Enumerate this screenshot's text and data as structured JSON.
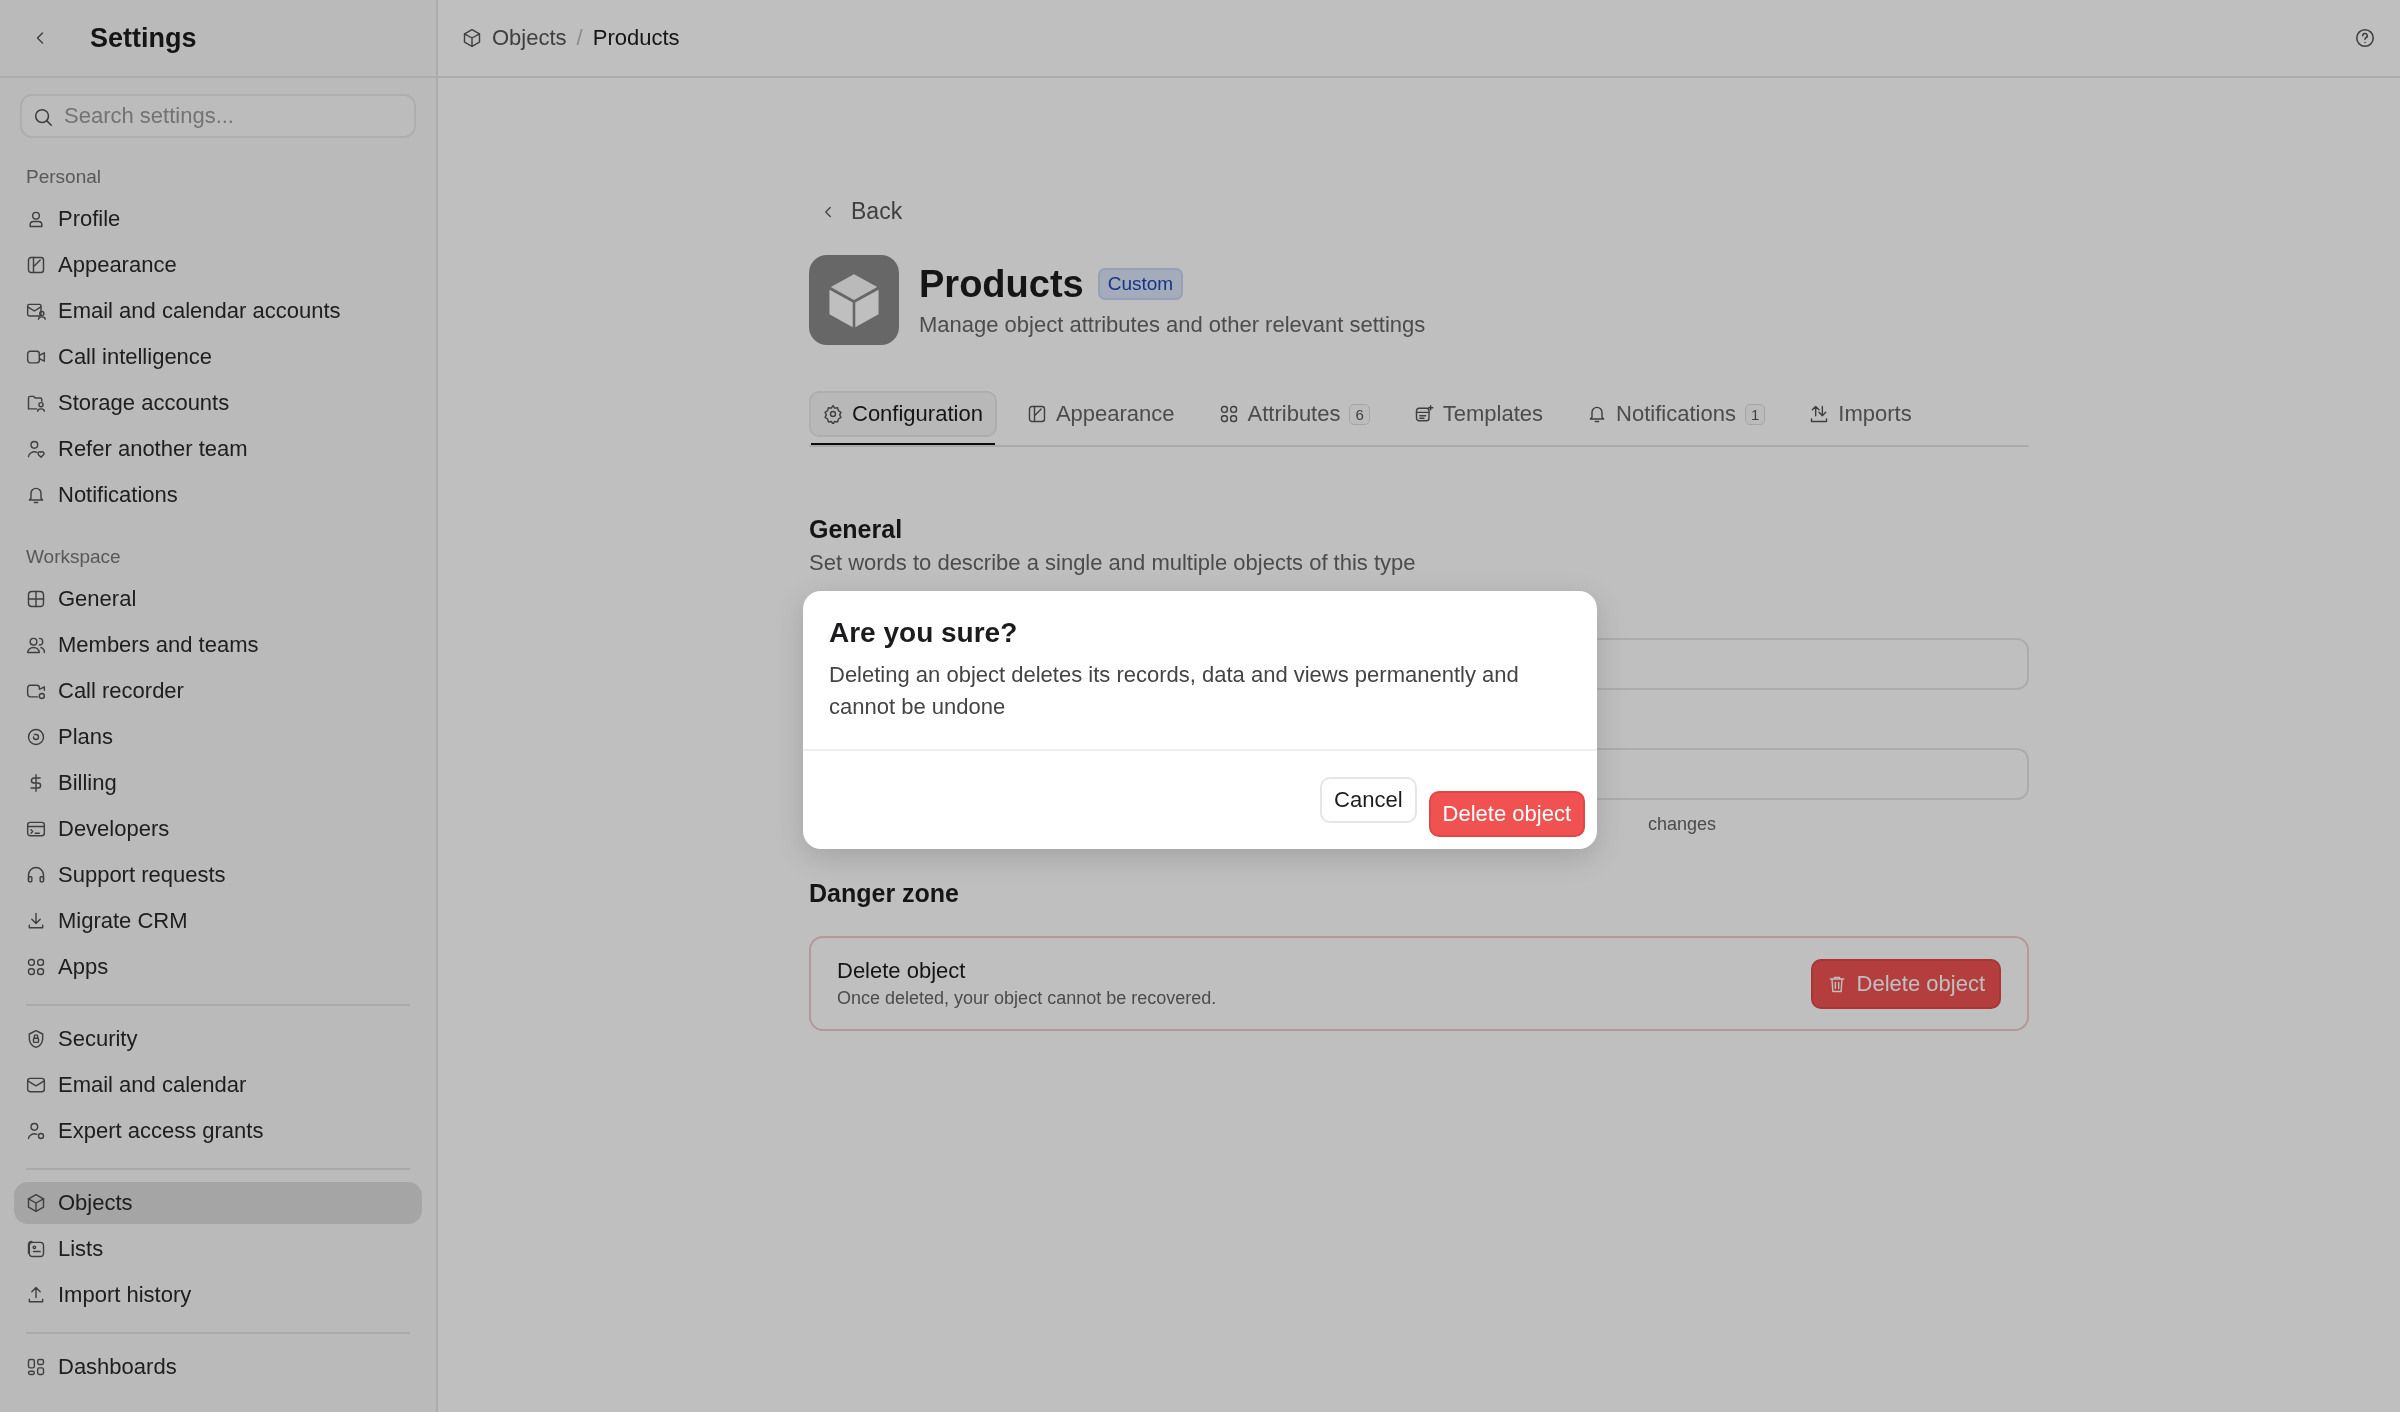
{
  "sidebar": {
    "title": "Settings",
    "search": {
      "placeholder": "Search settings..."
    },
    "groups": [
      {
        "label": "Personal",
        "items": [
          {
            "label": "Profile",
            "selected": false
          },
          {
            "label": "Appearance",
            "selected": false
          },
          {
            "label": "Email and calendar accounts",
            "selected": false
          },
          {
            "label": "Call intelligence",
            "selected": false
          },
          {
            "label": "Storage accounts",
            "selected": false
          },
          {
            "label": "Refer another team",
            "selected": false
          },
          {
            "label": "Notifications",
            "selected": false
          }
        ]
      },
      {
        "label": "Workspace",
        "items": [
          {
            "label": "General",
            "selected": false
          },
          {
            "label": "Members and teams",
            "selected": false
          },
          {
            "label": "Call recorder",
            "selected": false
          },
          {
            "label": "Plans",
            "selected": false
          },
          {
            "label": "Billing",
            "selected": false
          },
          {
            "label": "Developers",
            "selected": false
          },
          {
            "label": "Support requests",
            "selected": false
          },
          {
            "label": "Migrate CRM",
            "selected": false
          },
          {
            "label": "Apps",
            "selected": false
          }
        ]
      },
      {
        "items": [
          {
            "label": "Security",
            "selected": false
          },
          {
            "label": "Email and calendar",
            "selected": false
          },
          {
            "label": "Expert access grants",
            "selected": false
          }
        ]
      },
      {
        "items": [
          {
            "label": "Objects",
            "selected": true
          },
          {
            "label": "Lists",
            "selected": false
          },
          {
            "label": "Import history",
            "selected": false
          }
        ]
      },
      {
        "items": [
          {
            "label": "Dashboards",
            "selected": false
          }
        ]
      }
    ]
  },
  "breadcrumb": [
    "Objects",
    "Products"
  ],
  "breadcrumb_separator": "/",
  "page": {
    "back": "Back",
    "title": "Products",
    "badge": "Custom",
    "subtitle": "Manage object attributes and other relevant settings",
    "tabs": [
      {
        "label": "Configuration",
        "selected": true
      },
      {
        "label": "Appearance",
        "selected": false
      },
      {
        "label": "Attributes",
        "count": "6",
        "selected": false
      },
      {
        "label": "Templates",
        "selected": false
      },
      {
        "label": "Notifications",
        "count": "1",
        "selected": false
      },
      {
        "label": "Imports",
        "selected": false
      }
    ],
    "general": {
      "heading": "General",
      "description": "Set words to describe a single and multiple objects of this type",
      "hint": "changes"
    },
    "danger_zone": {
      "heading": "Danger zone",
      "title": "Delete object",
      "description": "Once deleted, your object cannot be recovered.",
      "button": "Delete object"
    }
  },
  "dialog": {
    "title": "Are you sure?",
    "message": "Deleting an object deletes its records, data and views permanently and cannot be undone",
    "buttons": [
      {
        "label": "Cancel",
        "kind": "secondary"
      },
      {
        "label": "Delete object",
        "kind": "danger"
      }
    ]
  }
}
